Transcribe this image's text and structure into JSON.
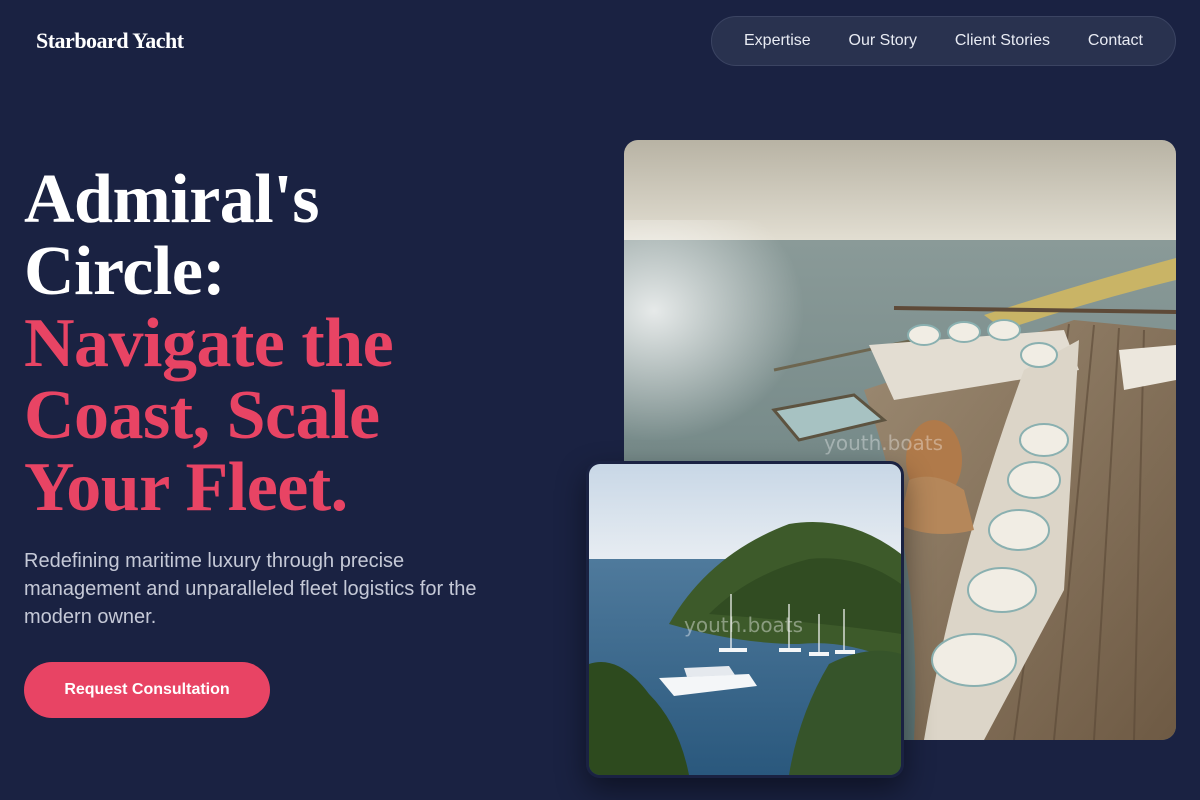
{
  "header": {
    "logo": "Starboard Yacht",
    "nav": [
      "Expertise",
      "Our Story",
      "Client Stories",
      "Contact"
    ]
  },
  "hero": {
    "headline_white": [
      "Admiral's",
      "Circle:"
    ],
    "headline_accent": [
      "Navigate the",
      "Coast, Scale",
      "Your Fleet."
    ],
    "subtext": "Redefining maritime luxury through precise management and unparalleled fleet logistics for the modern owner.",
    "cta": "Request Consultation"
  },
  "images": {
    "main_alt": "Woman lounging on a yacht deck sofa overlooking the sea",
    "main_watermark": "youth.boats",
    "small_alt": "Superyacht anchored in a green Mediterranean cove",
    "small_watermark": "youth.boats"
  },
  "colors": {
    "background": "#1a2242",
    "accent": "#e84464",
    "nav_bg": "#29324f"
  }
}
